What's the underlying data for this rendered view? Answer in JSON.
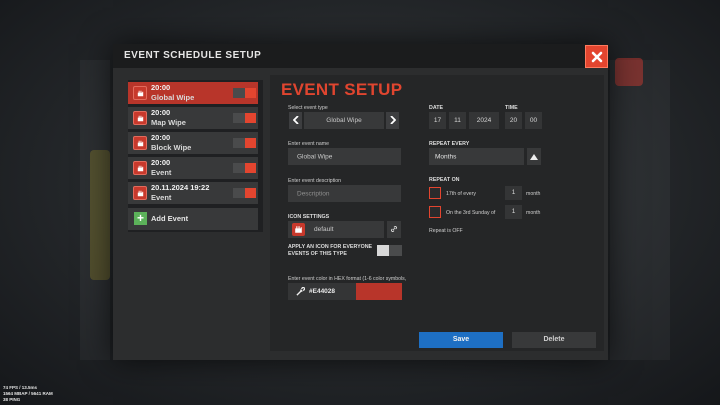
{
  "modal": {
    "title": "EVENT SCHEDULE SETUP"
  },
  "events": [
    {
      "time": "20:00",
      "name": "Global Wipe",
      "active": true
    },
    {
      "time": "20:00",
      "name": "Map Wipe",
      "active": false
    },
    {
      "time": "20:00",
      "name": "Block Wipe",
      "active": false
    },
    {
      "time": "20:00",
      "name": "Event",
      "active": false
    },
    {
      "time": "20.11.2024 19:22",
      "name": "Event",
      "active": false
    }
  ],
  "add_event_label": "Add Event",
  "setup": {
    "title": "EVENT SETUP",
    "event_type_label": "Select event type",
    "event_type_value": "Global Wipe",
    "event_name_label": "Enter event name",
    "event_name_value": "Global Wipe",
    "event_desc_label": "Enter event description",
    "event_desc_placeholder": "Description",
    "icon_settings_label": "ICON SETTINGS",
    "icon_value": "default",
    "apply_icon_label_1": "APPLY AN ICON FOR EVERYONE",
    "apply_icon_label_2": "EVENTS OF THIS TYPE",
    "color_label": "Enter event color in HEX format (1-6 color symbols,",
    "color_value": "#E44028",
    "color_swatch": "#b8352a"
  },
  "datetime": {
    "date_label": "DATE",
    "time_label": "TIME",
    "day": "17",
    "month": "11",
    "year": "2024",
    "hour": "20",
    "minute": "00"
  },
  "repeat": {
    "every_label": "REPEAT EVERY",
    "every_value": "Months",
    "on_label": "REPEAT ON",
    "option1_text": "17th of every",
    "option1_num": "1",
    "option1_unit": "month",
    "option2_text": "On the 3rd Sunday of",
    "option2_num": "1",
    "option2_unit": "month",
    "status": "Repeat is OFF"
  },
  "buttons": {
    "save": "Save",
    "delete": "Delete"
  },
  "hud": {
    "line1": "74 FPS / 13.5ms",
    "line2": "1564 MBAP / 5641 RAM",
    "line3": "38 PING"
  },
  "colors": {
    "accent": "#e3452f",
    "save_blue": "#1e6fc3"
  }
}
